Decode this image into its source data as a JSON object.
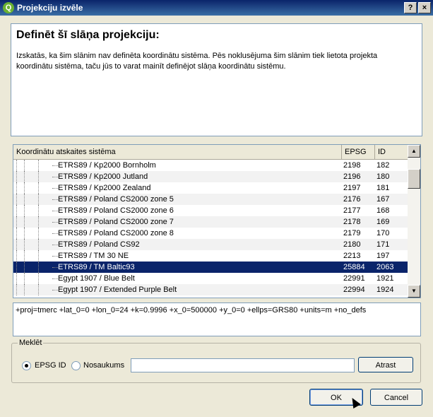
{
  "window": {
    "title": "Projekciju izvēle",
    "app_icon": "qgis-icon",
    "help_glyph": "?",
    "close_glyph": "×"
  },
  "header": {
    "title": "Definēt šī slāņa projekciju:",
    "description": "Izskatās, ka šim slānim nav definēta koordinātu sistēma. Pēs noklusējuma šim slānim tiek lietota projekta koordinātu sistēma, taču jūs to varat mainīt definējot slāņa koordinātu sistēmu."
  },
  "table": {
    "columns": [
      "Koordinātu atskaites sistēma",
      "EPSG",
      "ID"
    ],
    "rows": [
      {
        "name": "ETRS89 / Kp2000 Bornholm",
        "epsg": "2198",
        "id": "182"
      },
      {
        "name": "ETRS89 / Kp2000 Jutland",
        "epsg": "2196",
        "id": "180"
      },
      {
        "name": "ETRS89 / Kp2000 Zealand",
        "epsg": "2197",
        "id": "181"
      },
      {
        "name": "ETRS89 / Poland CS2000 zone 5",
        "epsg": "2176",
        "id": "167"
      },
      {
        "name": "ETRS89 / Poland CS2000 zone 6",
        "epsg": "2177",
        "id": "168"
      },
      {
        "name": "ETRS89 / Poland CS2000 zone 7",
        "epsg": "2178",
        "id": "169"
      },
      {
        "name": "ETRS89 / Poland CS2000 zone 8",
        "epsg": "2179",
        "id": "170"
      },
      {
        "name": "ETRS89 / Poland CS92",
        "epsg": "2180",
        "id": "171"
      },
      {
        "name": "ETRS89 / TM 30 NE",
        "epsg": "2213",
        "id": "197"
      },
      {
        "name": "ETRS89 / TM Baltic93",
        "epsg": "25884",
        "id": "2063"
      },
      {
        "name": "Egypt 1907 / Blue Belt",
        "epsg": "22991",
        "id": "1921"
      },
      {
        "name": "Egypt 1907 / Extended Purple Belt",
        "epsg": "22994",
        "id": "1924"
      }
    ],
    "selected_index": 9
  },
  "proj_string": "+proj=tmerc +lat_0=0 +lon_0=24 +k=0.9996 +x_0=500000 +y_0=0 +ellps=GRS80 +units=m +no_defs",
  "search": {
    "legend": "Meklēt",
    "option_epsg": "EPSG ID",
    "option_name": "Nosaukums",
    "value": "",
    "find_label": "Atrast"
  },
  "buttons": {
    "ok": "OK",
    "cancel": "Cancel"
  },
  "colors": {
    "selection": "#0a246a",
    "titlebar": "#0a246a"
  }
}
